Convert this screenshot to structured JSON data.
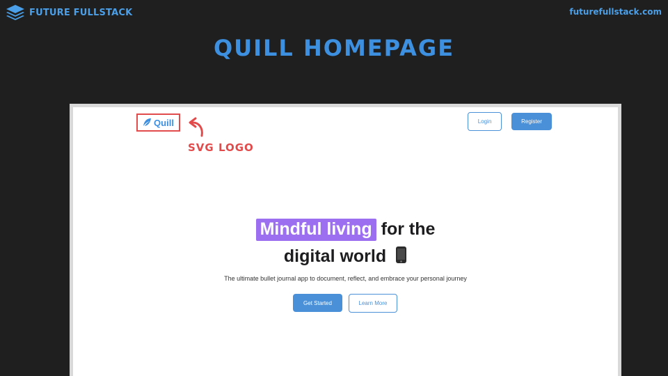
{
  "slide": {
    "brand_name": "FUTURE FULLSTACK",
    "brand_icon": "layers-icon",
    "site_url": "futurefullstack.com",
    "title": "QUILL HOMEPAGE"
  },
  "annotation": {
    "label": "SVG LOGO",
    "color": "#e24b4b"
  },
  "quill": {
    "logo_text": "Quill",
    "logo_icon": "feather-icon",
    "nav": {
      "login_label": "Login",
      "register_label": "Register"
    },
    "hero": {
      "highlight_text": "Mindful living",
      "line1_rest": "for the",
      "line2": "digital world",
      "emoji_icon": "mobile-phone-icon",
      "subtitle": "The ultimate bullet journal app to document, reflect, and embrace your personal journey",
      "primary_cta": "Get Started",
      "secondary_cta": "Learn More"
    }
  },
  "colors": {
    "accent_blue": "#4a90d9",
    "highlight_purple": "#9b6ff0",
    "background": "#1f1f1f"
  }
}
